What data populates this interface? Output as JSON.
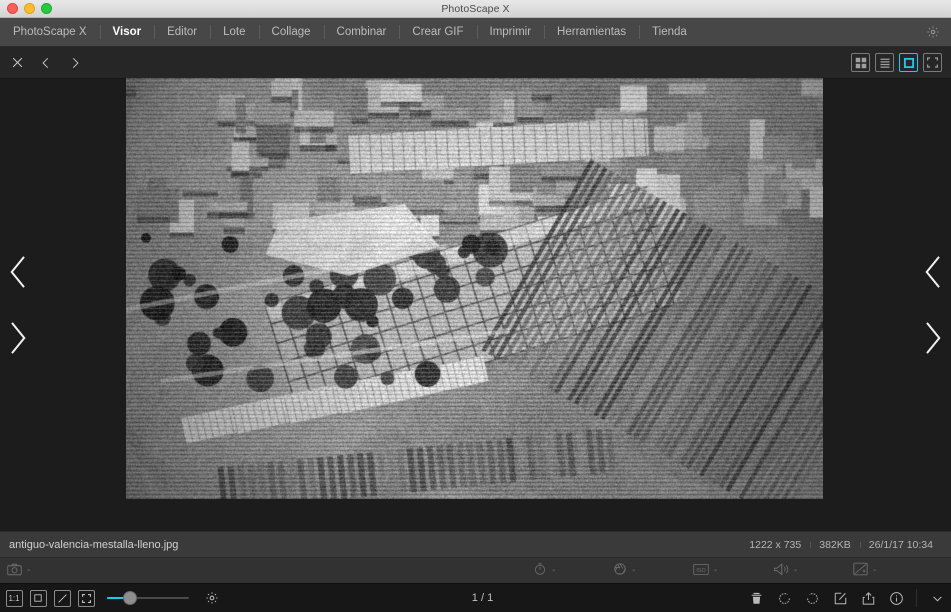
{
  "window": {
    "title": "PhotoScape X",
    "traffic_lights": [
      "close",
      "minimize",
      "maximize"
    ]
  },
  "menubar": {
    "items": [
      {
        "label": "PhotoScape X",
        "active": false
      },
      {
        "label": "Visor",
        "active": true
      },
      {
        "label": "Editor",
        "active": false
      },
      {
        "label": "Lote",
        "active": false
      },
      {
        "label": "Collage",
        "active": false
      },
      {
        "label": "Combinar",
        "active": false
      },
      {
        "label": "Crear GIF",
        "active": false
      },
      {
        "label": "Imprimir",
        "active": false
      },
      {
        "label": "Herramientas",
        "active": false
      },
      {
        "label": "Tienda",
        "active": false
      }
    ],
    "settings_icon": "gear-icon"
  },
  "subtoolbar": {
    "left_buttons": [
      {
        "name": "close-icon",
        "label": "×"
      },
      {
        "name": "previous-icon",
        "label": "‹"
      },
      {
        "name": "next-icon",
        "label": "›"
      }
    ],
    "view_modes": [
      {
        "name": "grid-view",
        "label": "grid-icon",
        "active": false
      },
      {
        "name": "list-view",
        "label": "list-icon",
        "active": false
      },
      {
        "name": "single-view",
        "label": "single-icon",
        "active": true
      },
      {
        "name": "fullscreen-view",
        "label": "fullscreen-icon",
        "active": false
      }
    ],
    "active_accent": "#1ec8ee"
  },
  "viewer": {
    "nav_prev": "‹",
    "nav_next": "›",
    "photo_alt": "Aerial black and white photograph of the old Mestalla stadium in Valencia"
  },
  "statusbar": {
    "filename": "antiguo-valencia-mestalla-lleno.jpg",
    "dimensions": "1222 x 735",
    "filesize": "382KB",
    "datetime": "26/1/17 10:34"
  },
  "exifbar": {
    "items": [
      {
        "icon": "camera-icon",
        "value": "-"
      },
      {
        "icon": "shutter-speed-icon",
        "value": "-"
      },
      {
        "icon": "aperture-icon",
        "value": "-"
      },
      {
        "icon": "iso-icon",
        "value": "-"
      },
      {
        "icon": "flash-icon",
        "value": "-"
      },
      {
        "icon": "exposure-compensation-icon",
        "value": "-"
      }
    ]
  },
  "bottombar": {
    "zoom_buttons": [
      {
        "name": "zoom-actual-size",
        "label": "1:1"
      },
      {
        "name": "zoom-fit-window",
        "label": "fit-icon"
      },
      {
        "name": "zoom-fill-window",
        "label": "fill-icon"
      },
      {
        "name": "zoom-fullscreen",
        "label": "expand-icon"
      }
    ],
    "zoom_slider_value": 25,
    "slider_accent": "#1ec8ee",
    "settings_icon": "gear-icon",
    "page_indicator": "1 / 1",
    "right_buttons": [
      {
        "name": "delete-icon",
        "label": "trash"
      },
      {
        "name": "rotate-left-icon",
        "label": "rotate-ccw"
      },
      {
        "name": "rotate-right-icon",
        "label": "rotate-cw"
      },
      {
        "name": "edit-icon",
        "label": "edit"
      },
      {
        "name": "share-icon",
        "label": "share"
      },
      {
        "name": "info-icon",
        "label": "info"
      }
    ],
    "collapse_icon": "chevron-down-icon"
  }
}
